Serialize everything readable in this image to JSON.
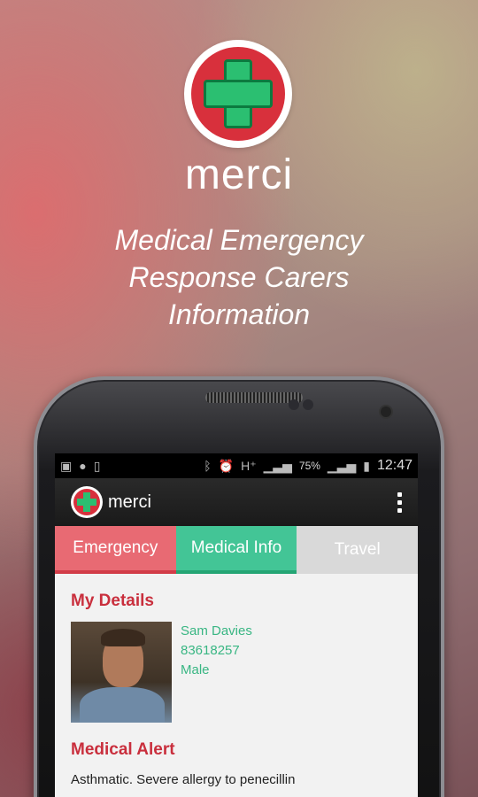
{
  "promo": {
    "brand": "merci",
    "tagline_1": "Medical Emergency",
    "tagline_2": "Response Carers",
    "tagline_3": "Information"
  },
  "status_bar": {
    "battery_percent": "75%",
    "time": "12:47",
    "icons": [
      "image-icon",
      "chat-icon",
      "phone-icon",
      "bluetooth-icon",
      "alarm-icon",
      "hplus-icon",
      "signal-icon",
      "signal-icon",
      "battery-icon"
    ]
  },
  "action_bar": {
    "title": "merci"
  },
  "tabs": [
    {
      "label": "Emergency",
      "color": "#e86a73"
    },
    {
      "label": "Medical Info",
      "color": "#43c596"
    },
    {
      "label": "Travel",
      "color": "#d9d9d9"
    }
  ],
  "my_details": {
    "title": "My Details",
    "name": "Sam Davies",
    "number": "83618257",
    "gender": "Male"
  },
  "medical_alert": {
    "title": "Medical Alert",
    "text": "Asthmatic. Severe allergy to penecillin"
  },
  "colors": {
    "accent_red": "#c92f3d",
    "accent_green": "#39b683"
  }
}
